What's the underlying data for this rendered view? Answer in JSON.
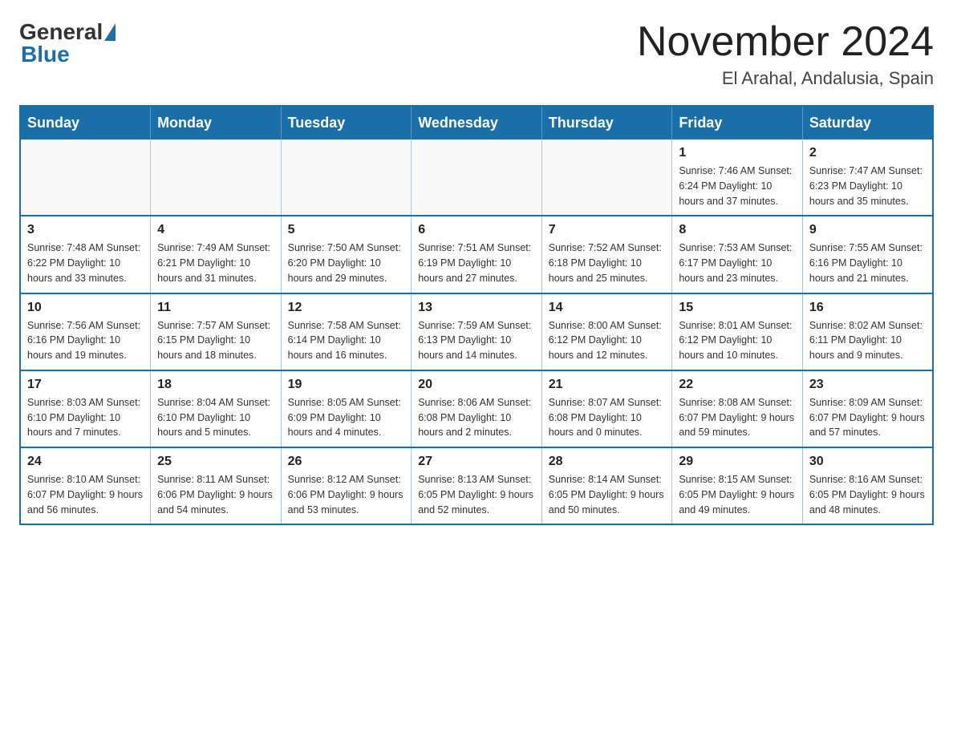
{
  "header": {
    "logo_general": "General",
    "logo_blue": "Blue",
    "month_title": "November 2024",
    "location": "El Arahal, Andalusia, Spain"
  },
  "weekdays": [
    "Sunday",
    "Monday",
    "Tuesday",
    "Wednesday",
    "Thursday",
    "Friday",
    "Saturday"
  ],
  "weeks": [
    [
      {
        "day": "",
        "info": ""
      },
      {
        "day": "",
        "info": ""
      },
      {
        "day": "",
        "info": ""
      },
      {
        "day": "",
        "info": ""
      },
      {
        "day": "",
        "info": ""
      },
      {
        "day": "1",
        "info": "Sunrise: 7:46 AM\nSunset: 6:24 PM\nDaylight: 10 hours and 37 minutes."
      },
      {
        "day": "2",
        "info": "Sunrise: 7:47 AM\nSunset: 6:23 PM\nDaylight: 10 hours and 35 minutes."
      }
    ],
    [
      {
        "day": "3",
        "info": "Sunrise: 7:48 AM\nSunset: 6:22 PM\nDaylight: 10 hours and 33 minutes."
      },
      {
        "day": "4",
        "info": "Sunrise: 7:49 AM\nSunset: 6:21 PM\nDaylight: 10 hours and 31 minutes."
      },
      {
        "day": "5",
        "info": "Sunrise: 7:50 AM\nSunset: 6:20 PM\nDaylight: 10 hours and 29 minutes."
      },
      {
        "day": "6",
        "info": "Sunrise: 7:51 AM\nSunset: 6:19 PM\nDaylight: 10 hours and 27 minutes."
      },
      {
        "day": "7",
        "info": "Sunrise: 7:52 AM\nSunset: 6:18 PM\nDaylight: 10 hours and 25 minutes."
      },
      {
        "day": "8",
        "info": "Sunrise: 7:53 AM\nSunset: 6:17 PM\nDaylight: 10 hours and 23 minutes."
      },
      {
        "day": "9",
        "info": "Sunrise: 7:55 AM\nSunset: 6:16 PM\nDaylight: 10 hours and 21 minutes."
      }
    ],
    [
      {
        "day": "10",
        "info": "Sunrise: 7:56 AM\nSunset: 6:16 PM\nDaylight: 10 hours and 19 minutes."
      },
      {
        "day": "11",
        "info": "Sunrise: 7:57 AM\nSunset: 6:15 PM\nDaylight: 10 hours and 18 minutes."
      },
      {
        "day": "12",
        "info": "Sunrise: 7:58 AM\nSunset: 6:14 PM\nDaylight: 10 hours and 16 minutes."
      },
      {
        "day": "13",
        "info": "Sunrise: 7:59 AM\nSunset: 6:13 PM\nDaylight: 10 hours and 14 minutes."
      },
      {
        "day": "14",
        "info": "Sunrise: 8:00 AM\nSunset: 6:12 PM\nDaylight: 10 hours and 12 minutes."
      },
      {
        "day": "15",
        "info": "Sunrise: 8:01 AM\nSunset: 6:12 PM\nDaylight: 10 hours and 10 minutes."
      },
      {
        "day": "16",
        "info": "Sunrise: 8:02 AM\nSunset: 6:11 PM\nDaylight: 10 hours and 9 minutes."
      }
    ],
    [
      {
        "day": "17",
        "info": "Sunrise: 8:03 AM\nSunset: 6:10 PM\nDaylight: 10 hours and 7 minutes."
      },
      {
        "day": "18",
        "info": "Sunrise: 8:04 AM\nSunset: 6:10 PM\nDaylight: 10 hours and 5 minutes."
      },
      {
        "day": "19",
        "info": "Sunrise: 8:05 AM\nSunset: 6:09 PM\nDaylight: 10 hours and 4 minutes."
      },
      {
        "day": "20",
        "info": "Sunrise: 8:06 AM\nSunset: 6:08 PM\nDaylight: 10 hours and 2 minutes."
      },
      {
        "day": "21",
        "info": "Sunrise: 8:07 AM\nSunset: 6:08 PM\nDaylight: 10 hours and 0 minutes."
      },
      {
        "day": "22",
        "info": "Sunrise: 8:08 AM\nSunset: 6:07 PM\nDaylight: 9 hours and 59 minutes."
      },
      {
        "day": "23",
        "info": "Sunrise: 8:09 AM\nSunset: 6:07 PM\nDaylight: 9 hours and 57 minutes."
      }
    ],
    [
      {
        "day": "24",
        "info": "Sunrise: 8:10 AM\nSunset: 6:07 PM\nDaylight: 9 hours and 56 minutes."
      },
      {
        "day": "25",
        "info": "Sunrise: 8:11 AM\nSunset: 6:06 PM\nDaylight: 9 hours and 54 minutes."
      },
      {
        "day": "26",
        "info": "Sunrise: 8:12 AM\nSunset: 6:06 PM\nDaylight: 9 hours and 53 minutes."
      },
      {
        "day": "27",
        "info": "Sunrise: 8:13 AM\nSunset: 6:05 PM\nDaylight: 9 hours and 52 minutes."
      },
      {
        "day": "28",
        "info": "Sunrise: 8:14 AM\nSunset: 6:05 PM\nDaylight: 9 hours and 50 minutes."
      },
      {
        "day": "29",
        "info": "Sunrise: 8:15 AM\nSunset: 6:05 PM\nDaylight: 9 hours and 49 minutes."
      },
      {
        "day": "30",
        "info": "Sunrise: 8:16 AM\nSunset: 6:05 PM\nDaylight: 9 hours and 48 minutes."
      }
    ]
  ]
}
